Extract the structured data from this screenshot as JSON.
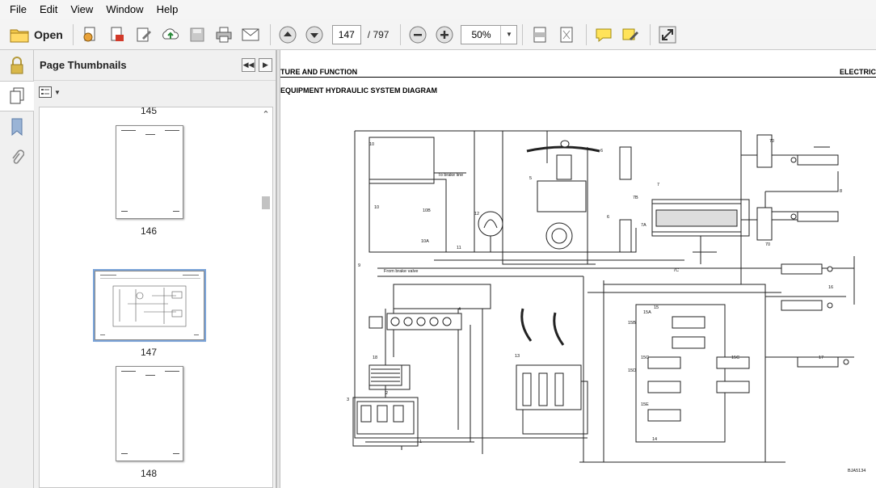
{
  "menu": [
    "File",
    "Edit",
    "View",
    "Window",
    "Help"
  ],
  "toolbar": {
    "open_label": "Open",
    "current_page": "147",
    "total_pages": "/ 797",
    "zoom": "50%"
  },
  "panel": {
    "title": "Page Thumbnails"
  },
  "thumbnails": [
    {
      "page": "145"
    },
    {
      "page": "146"
    },
    {
      "page": "147"
    },
    {
      "page": "148"
    }
  ],
  "document": {
    "header_left": "TURE AND FUNCTION",
    "header_right": "ELECTRIC",
    "title": "EQUIPMENT HYDRAULIC SYSTEM DIAGRAM",
    "labels": {
      "to_brake_line": "To brake line",
      "from_brake_valve": "From brake valve",
      "n1": "1",
      "n2": "2",
      "n3": "3",
      "n4": "4",
      "n5": "5",
      "n6a": "6",
      "n6b": "6",
      "n7": "7",
      "n7b": "7B",
      "n7a": "7A",
      "n7c": "7C",
      "n70a": "70",
      "n70b": "70",
      "n8": "8",
      "n9": "9",
      "n10": "10",
      "n10b": "10B",
      "n10a": "10A",
      "n10c": "10",
      "n11": "11",
      "n12": "12",
      "n13": "13",
      "n14": "14",
      "n15": "15",
      "n15a": "15A",
      "n15b": "15B",
      "n15c": "15C",
      "n15c2": "15C",
      "n15d": "15D",
      "n15e": "15E",
      "n16": "16",
      "n17": "17",
      "n18": "18",
      "ref": "BJA5134"
    }
  }
}
